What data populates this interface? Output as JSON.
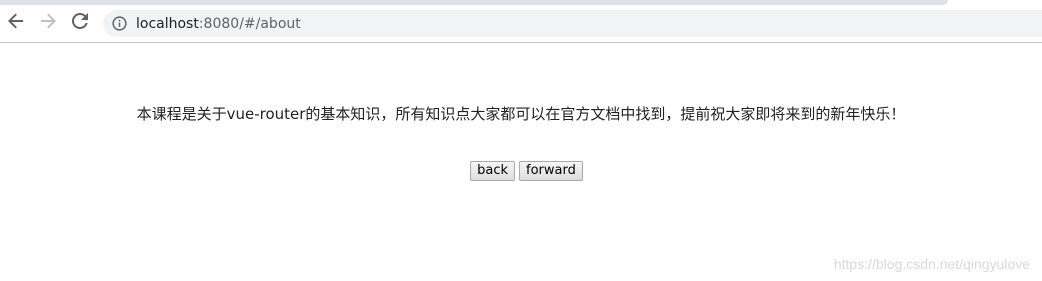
{
  "browser": {
    "nav_icons": [
      "back-arrow-icon",
      "forward-arrow-icon",
      "reload-icon"
    ],
    "site_info_icon": "info-icon",
    "url_host": "localhost",
    "url_path": ":8080/#/about"
  },
  "page": {
    "message": "本课程是关于vue-router的基本知识，所有知识点大家都可以在官方文档中找到，提前祝大家即将来到的新年快乐！",
    "back_label": "back",
    "forward_label": "forward"
  },
  "watermark": "https://blog.csdn.net/qingyulove"
}
